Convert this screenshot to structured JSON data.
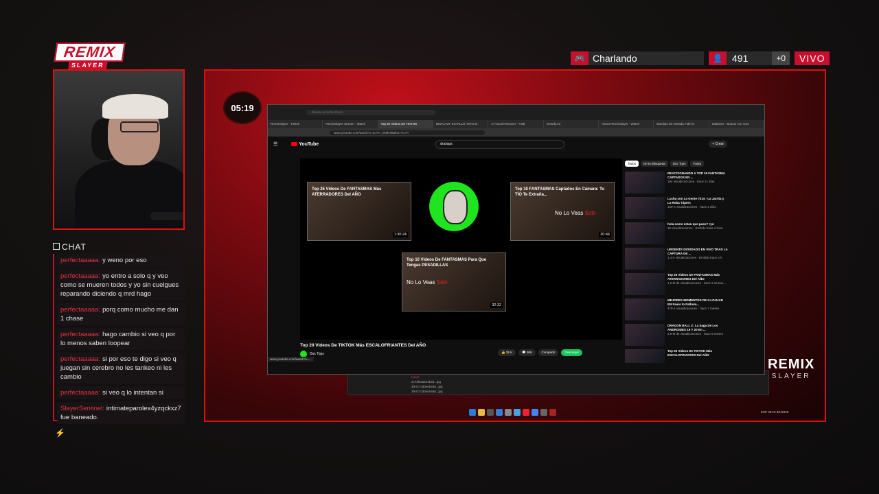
{
  "logo": {
    "main": "REMIX",
    "sub": "SLAYER"
  },
  "topbar": {
    "game": "Charlando",
    "viewers": "491",
    "followers_delta": "+0",
    "live": "VIVO"
  },
  "timer": "05:19",
  "chat": {
    "title": "CHAT",
    "messages": [
      {
        "user": "perfectaaaaa:",
        "text": "y weno por eso"
      },
      {
        "user": "perfectaaaaa:",
        "text": "yo entro a solo q y veo como se mueren todos y yo sin cuelgues reparando diciendo q mrd hago"
      },
      {
        "user": "perfectaaaaa:",
        "text": "porq como mucho me dan 1 chase"
      },
      {
        "user": "perfectaaaaa:",
        "text": "hago cambio si veo q por lo menos saben loopear"
      },
      {
        "user": "perfectaaaaa:",
        "text": "si por eso te digo si veo q juegan sin cerebro no les tankeo ni les cambio"
      },
      {
        "user": "perfectaaaaa:",
        "text": "si veo q lo intentan si"
      },
      {
        "user": "SlayerSentinel:",
        "text": "intimateparolex4yzqckxz7 fue baneado."
      }
    ]
  },
  "overlay_logo": {
    "main": "REMIX",
    "sub": "SLAYER"
  },
  "browser": {
    "search_hint": "Buscar en la Escritorio",
    "tabs": [
      "RemixSlayer - Twitch",
      "RemixSlayer Stream - Watch",
      "Top 20 Videos De TIKTOK",
      "BUKCAUF ESTALLÓ TRAS D",
      "AI Vocal Remover - Fadr",
      "melody.ml",
      "About RemixSlayer - Watch",
      "Bandeja de entrada Fidel G",
      "traductor - Buscar con Goo"
    ],
    "url": "www.youtube.com/watch?v=acTH_X8MOl8&list=TCYA",
    "youtube": {
      "brand": "YouTube",
      "search": "doctops",
      "create": "+ Crear",
      "thumbs": [
        {
          "title": "Top 25 Videos De FANTASMAS Más ATERRADORES Del AÑO",
          "duration": "1:30:24"
        },
        {
          "title": "Top 10 FANTASMAS Captados En Cámara: Tu TÍO Te Extraña...",
          "duration": "30:46",
          "overlay": "No Lo Veas",
          "overlay_red": "Solo"
        },
        {
          "title": "Top 10 Videos De FANTASMAS Para Que Tengas PESADILLAS",
          "duration": "32:32",
          "overlay": "No Lo Veas",
          "overlay_red": "Solo"
        }
      ],
      "video_title": "Top 20 Videos De TIKTOK Más ESCALOFRIANTES Del AÑO",
      "channel": "Doc Tops",
      "actions": [
        "35 K",
        "306",
        "Compartir",
        "Descargar"
      ],
      "chips": [
        "Todos",
        "De tu búsqueda",
        "Doc Tops",
        "Fanta"
      ],
      "related": [
        {
          "title": "REACCIONANDO A TOP 15 FANTASMA CAPTADOS EN ...",
          "meta": "194 visualizaciones · hace 11 días"
        },
        {
          "title": "Lucha con La Gente #214 - La Jarrita y La Roba Tápers",
          "meta": "169 K visualizaciones · hace 2 días"
        },
        {
          "title": "hola como estan que paso? ryo",
          "meta": "15 visualizaciones · Emitido hace 1 hora"
        },
        {
          "title": "URGENTE DIOSDADO EN VIVO TRAS LA CAPTURA DE ...",
          "meta": "1,4 K visualizaciones · Emitido hace 4 h"
        },
        {
          "title": "Top 25 Videos De FANTASMAS Más ATERRADORES Del AÑO",
          "meta": "1,2 M de visualizaciones · hace 2 seman..."
        },
        {
          "title": "MEJORES MOMENTOS DE ILLOJUAN EN Fears to Fathom...",
          "meta": "479 K visualizaciones · hace 7 meses"
        },
        {
          "title": "DRAGON BALL Z: La Saga De Los ANDROIDES 19 Y 20 En ...",
          "meta": "2,6 M de visualizaciones · hace 5 meses"
        },
        {
          "title": "Top 25 Videos De TIKTOK Más ESCALOFRIANTES Del AÑO",
          "meta": ""
        }
      ],
      "status_url": "www.youtube.com/watch?v=..."
    }
  },
  "explorer": {
    "files": [
      "Lanar",
      "2c73fc5a6e4b4d...jpg",
      "3fe7c7cd0eeb49d...jpg",
      "3fe7c7cd0eeb49d...jpg"
    ]
  },
  "tray": {
    "time": "03:19",
    "date": "8/1/2026",
    "lang": "ESP"
  }
}
